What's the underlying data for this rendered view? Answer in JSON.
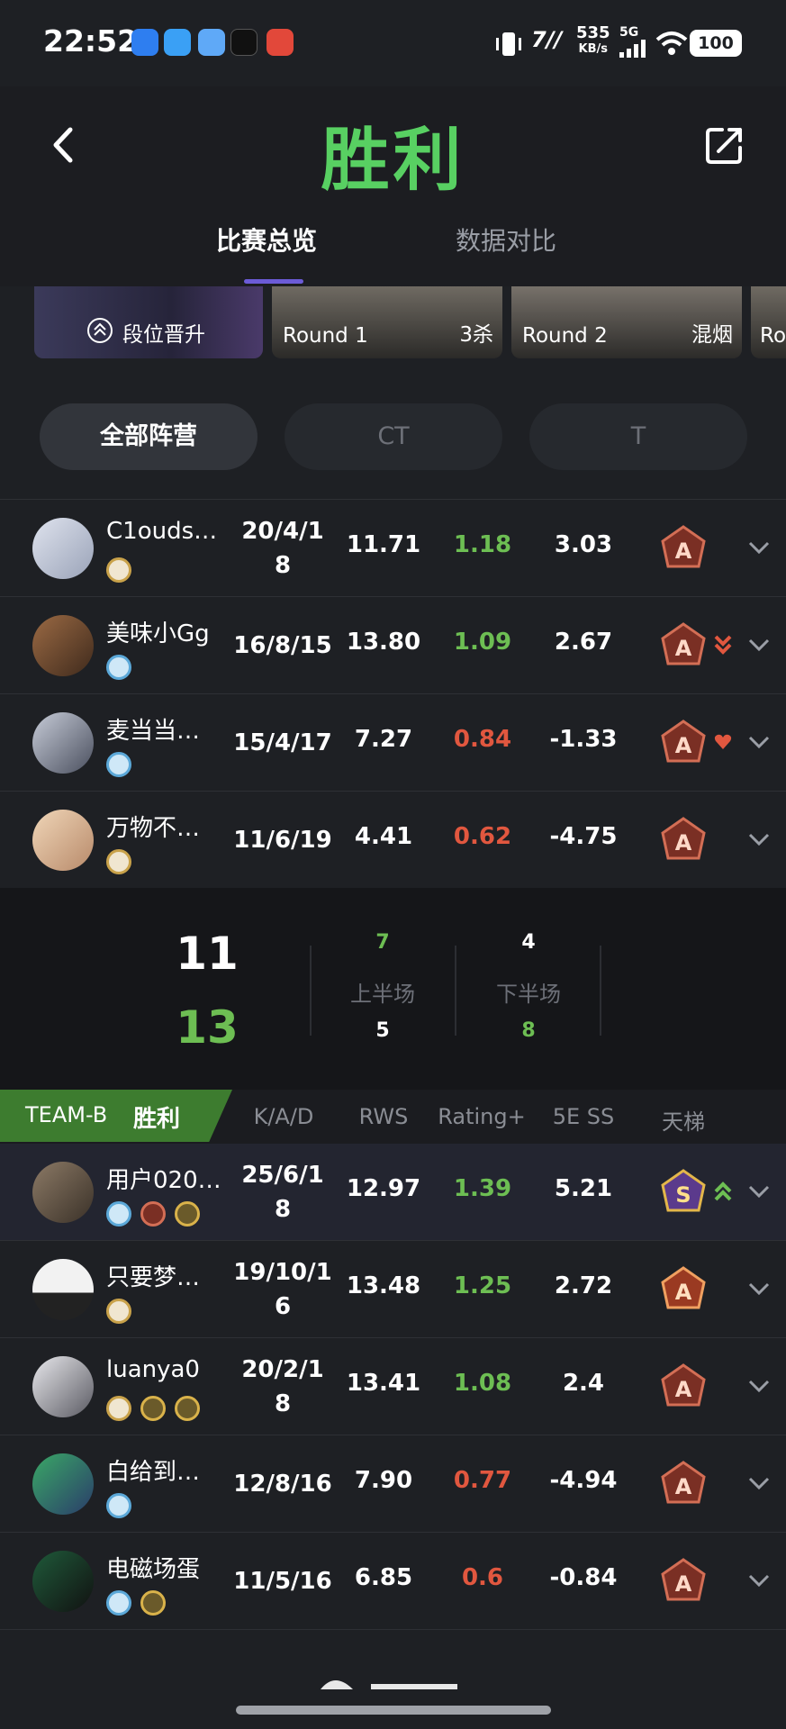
{
  "status_bar": {
    "time": "22:52",
    "network_speed_value": "535",
    "network_speed_unit": "KB/s",
    "signal_type": "5G",
    "battery": "100"
  },
  "header": {
    "title": "胜利",
    "tabs": [
      {
        "label": "比赛总览",
        "active": true
      },
      {
        "label": "数据对比",
        "active": false
      }
    ]
  },
  "highlights": [
    {
      "label": "段位晋升"
    },
    {
      "label": "Round 1",
      "tag": "3杀"
    },
    {
      "label": "Round 2",
      "tag": "混烟"
    },
    {
      "label": "Ro"
    }
  ],
  "camp_filter": [
    {
      "label": "全部阵营",
      "active": true
    },
    {
      "label": "CT",
      "active": false
    },
    {
      "label": "T",
      "active": false
    }
  ],
  "team_a": {
    "players": [
      {
        "name": "C1ouds…",
        "kda_line1": "20/4/1",
        "kda_line2": "8",
        "rws": "11.71",
        "rating": "1.18",
        "rating_color": "#6dbe53",
        "ss": "3.03",
        "trend": ""
      },
      {
        "name": "美味小Gg",
        "kda_line1": "16/8/15",
        "kda_line2": "",
        "rws": "13.80",
        "rating": "1.09",
        "rating_color": "#6dbe53",
        "ss": "2.67",
        "trend": "down"
      },
      {
        "name": "麦当当…",
        "kda_line1": "15/4/17",
        "kda_line2": "",
        "rws": "7.27",
        "rating": "0.84",
        "rating_color": "#e1573f",
        "ss": "-1.33",
        "trend": "heart"
      },
      {
        "name": "万物不…",
        "kda_line1": "11/6/19",
        "kda_line2": "",
        "rws": "4.41",
        "rating": "0.62",
        "rating_color": "#e1573f",
        "ss": "-4.75",
        "trend": ""
      }
    ]
  },
  "score": {
    "team_a_total": "11",
    "team_b_total": "13",
    "first_half": {
      "label": "上半场",
      "team_a": "7",
      "team_b": "5"
    },
    "second_half": {
      "label": "下半场",
      "team_a": "4",
      "team_b": "8"
    }
  },
  "team_b_header": {
    "team": "TEAM-B",
    "result": "胜利",
    "columns": [
      "K/A/D",
      "RWS",
      "Rating+",
      "5E SS",
      "天梯"
    ]
  },
  "team_b": {
    "players": [
      {
        "name": "用户020…",
        "kda_line1": "25/6/1",
        "kda_line2": "8",
        "rws": "12.97",
        "rating": "1.39",
        "rating_color": "#6dbe53",
        "ss": "5.21",
        "trend": "up",
        "mvp": true
      },
      {
        "name": "只要梦…",
        "kda_line1": "19/10/1",
        "kda_line2": "6",
        "rws": "13.48",
        "rating": "1.25",
        "rating_color": "#6dbe53",
        "ss": "2.72",
        "trend": ""
      },
      {
        "name": "luanya0",
        "kda_line1": "20/2/1",
        "kda_line2": "8",
        "rws": "13.41",
        "rating": "1.08",
        "rating_color": "#6dbe53",
        "ss": "2.4",
        "trend": ""
      },
      {
        "name": "白给到…",
        "kda_line1": "12/8/16",
        "kda_line2": "",
        "rws": "7.90",
        "rating": "0.77",
        "rating_color": "#e1573f",
        "ss": "-4.94",
        "trend": ""
      },
      {
        "name": "电磁场蛋",
        "kda_line1": "11/5/16",
        "kda_line2": "",
        "rws": "6.85",
        "rating": "0.6",
        "rating_color": "#e1573f",
        "ss": "-0.84",
        "trend": ""
      }
    ]
  },
  "colors": {
    "win_green": "#58d062",
    "positive": "#6dbe53",
    "negative": "#e1573f",
    "accent": "#6c5bd7",
    "team_b_bar": "#3d7c2f"
  }
}
